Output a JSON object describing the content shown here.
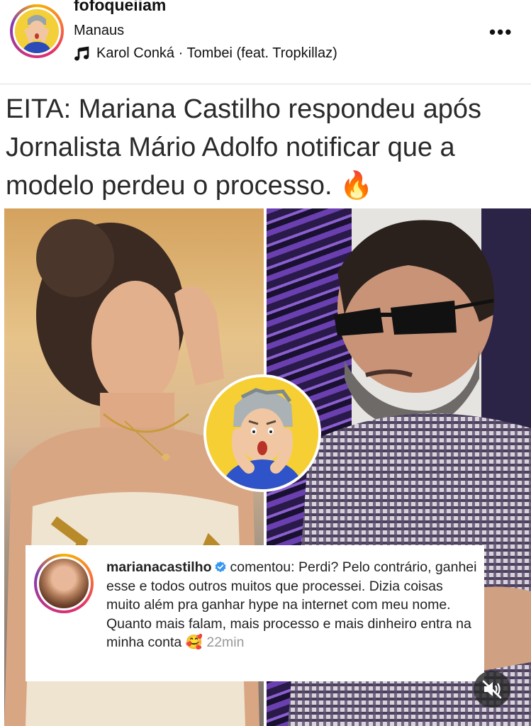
{
  "header": {
    "username": "fofoqueiiam",
    "location": "Manaus",
    "music": "Karol Conká · Tombei (feat. Tropkillaz)",
    "more": "•••"
  },
  "post": {
    "headline": "EITA: Mariana Castilho respondeu após Jornalista Mário Adolfo notificar que a modelo perdeu o processo.",
    "headline_emoji": "🔥",
    "comment": {
      "username": "marianacastilho",
      "action": "comentou:",
      "text": "Perdi? Pelo contrário, ganhei esse e todos outros muitos que processei. Dizia coisas muito além pra ganhar hype na internet com meu nome. Quanto mais falam, mais processo e mais dinheiro entra na minha conta",
      "emoji": "🥰",
      "time": "22min"
    }
  },
  "icons": {
    "music": "music-note-icon",
    "more": "more-options-icon",
    "verified": "verified-badge-icon",
    "mute": "speaker-muted-icon"
  },
  "colors": {
    "verified": "#3897f0",
    "text": "#222222",
    "muted_text": "#999999"
  }
}
